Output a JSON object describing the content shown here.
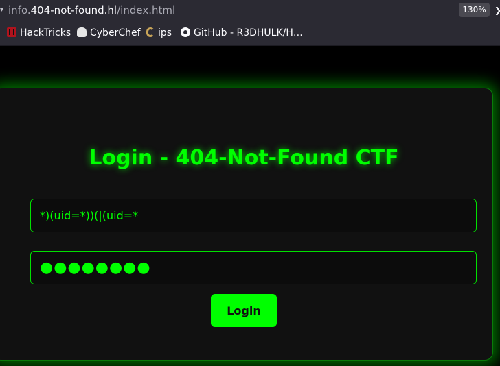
{
  "browser": {
    "url_prefix": "info.",
    "url_domain": "404-not-found.hl",
    "url_path": "/index.html",
    "zoom": "130%"
  },
  "bookmarks": [
    {
      "label": "HackTricks",
      "icon": "hacktricks-icon"
    },
    {
      "label": "CyberChef",
      "icon": "cyberchef-icon"
    },
    {
      "label": "ips",
      "icon": "ips-icon"
    },
    {
      "label": "GitHub - R3DHULK/H…",
      "icon": "github-icon"
    }
  ],
  "login": {
    "title": "Login - 404-Not-Found CTF",
    "username_value": "*)(uid=*))(|(uid=*",
    "password_mask": "●●●●●●●●",
    "button_label": "Login"
  },
  "colors": {
    "accent": "#00ff00",
    "card_bg": "#111111",
    "page_bg": "#000000",
    "toolbar_bg": "#2b2a33"
  }
}
